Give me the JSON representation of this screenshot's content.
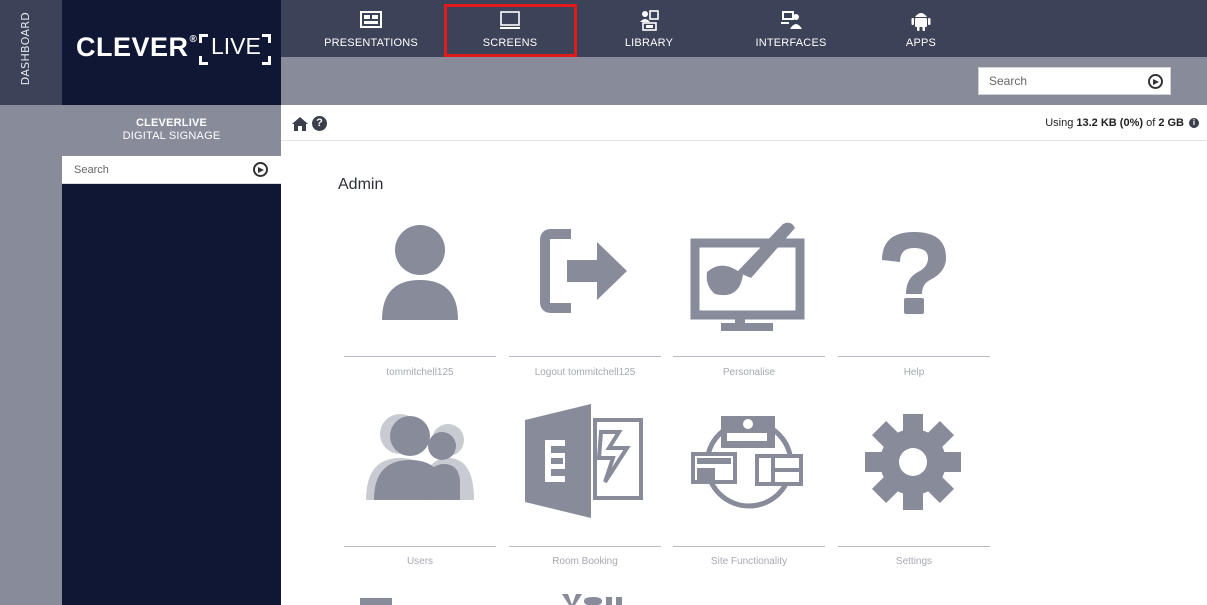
{
  "dashboard": {
    "label": "DASHBOARD"
  },
  "brand": {
    "name": "CLEVER",
    "mark": "®",
    "live": "LIVE"
  },
  "nav": {
    "items": [
      {
        "label": "PRESENTATIONS",
        "icon": "presentations-icon"
      },
      {
        "label": "SCREENS",
        "icon": "screen-icon",
        "highlighted": true
      },
      {
        "label": "LIBRARY",
        "icon": "library-icon"
      },
      {
        "label": "INTERFACES",
        "icon": "interfaces-icon"
      },
      {
        "label": "APPS",
        "icon": "android-icon"
      }
    ],
    "search_placeholder": "Search"
  },
  "sidebar": {
    "title": "CLEVERLIVE",
    "subtitle": "DIGITAL SIGNAGE",
    "search_placeholder": "Search"
  },
  "breadcrumb": {
    "home_icon": "home-icon",
    "help_icon": "question-circle-icon"
  },
  "storage": {
    "prefix": "Using ",
    "used": "13.2 KB (0%)",
    "middle": " of ",
    "total": "2 GB"
  },
  "content": {
    "section_title": "Admin",
    "tiles": [
      {
        "label": "tommitchell125",
        "icon": "user-icon"
      },
      {
        "label": "Logout tommitchell125",
        "icon": "logout-icon"
      },
      {
        "label": "Personalise",
        "icon": "personalise-icon"
      },
      {
        "label": "Help",
        "icon": "help-icon"
      },
      {
        "label": "Users",
        "icon": "users-icon"
      },
      {
        "label": "Room Booking",
        "icon": "exchange-icon"
      },
      {
        "label": "Site Functionality",
        "icon": "site-functionality-icon"
      },
      {
        "label": "Settings",
        "icon": "gear-icon"
      }
    ]
  },
  "colors": {
    "nav_dark": "#3c4257",
    "nav_gray": "#878b9a",
    "sidebar": "#0f1735",
    "icon_gray": "#878b9a",
    "highlight": "#e01b1b"
  }
}
